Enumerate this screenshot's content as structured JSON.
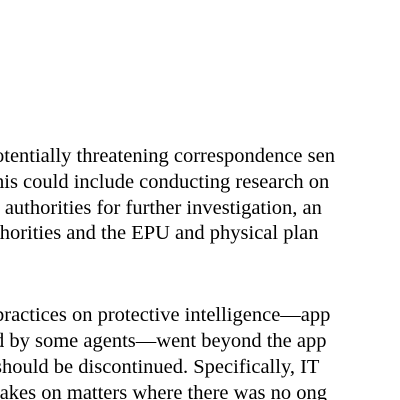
{
  "document": {
    "paragraph_1": {
      "lines": [
        "otentially threatening correspondence sen",
        "his could include conducting research on",
        "t authorities for further investigation, an",
        "thorities and the EPU and physical plan",
        "."
      ]
    },
    "paragraph_2": {
      "lines": [
        "practices on protective intelligence—app",
        "d by some agents—went beyond the app",
        " should be discontinued. Specifically, IT",
        "takes on matters where there was no ong"
      ]
    }
  }
}
